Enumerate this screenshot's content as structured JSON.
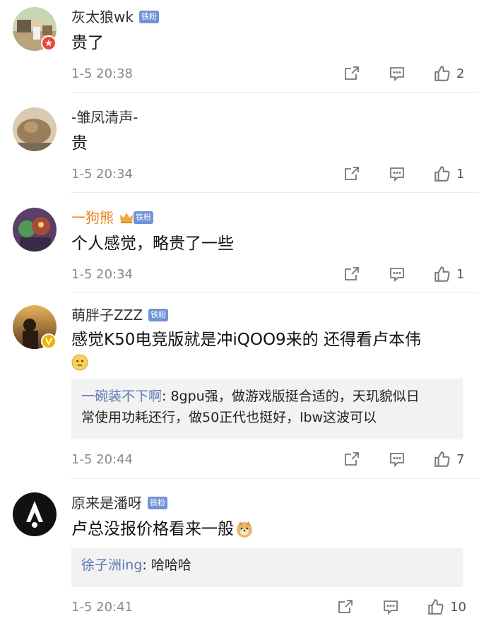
{
  "comments": [
    {
      "username": "灰太狼wk",
      "badge": "铁粉",
      "text": "贵了",
      "time": "1-5 20:38",
      "likes": "2"
    },
    {
      "username": "-雏凤清声-",
      "text": "贵",
      "time": "1-5 20:34",
      "likes": "1"
    },
    {
      "username": "一狗熊",
      "badge": "铁粉",
      "text": "个人感觉，略贵了一些",
      "time": "1-5 20:34",
      "likes": "1"
    },
    {
      "username": "萌胖子ZZZ",
      "badge": "铁粉",
      "text": "感觉K50电竞版就是冲iQOO9来的  还得看卢本伟",
      "reply_user": "一碗装不下啊",
      "reply_line1": ": 8gpu强，做游戏版挺合适的，天玑貌似日",
      "reply_line2": "常使用功耗还行，做50正代也挺好，lbw这波可以",
      "time": "1-5 20:44",
      "likes": "7"
    },
    {
      "username": "原来是潘呀",
      "badge": "铁粉",
      "text": "卢总没报价格看来一般",
      "reply_user": "徐子洲ing",
      "reply_text": ": 哈哈哈",
      "time": "1-5 20:41",
      "likes": "10"
    }
  ],
  "colors": {
    "username": "#333333",
    "username_highlight": "#e8821b",
    "reply_user": "#5b78b0",
    "badge": "#6f93d6",
    "meta": "#888888"
  }
}
